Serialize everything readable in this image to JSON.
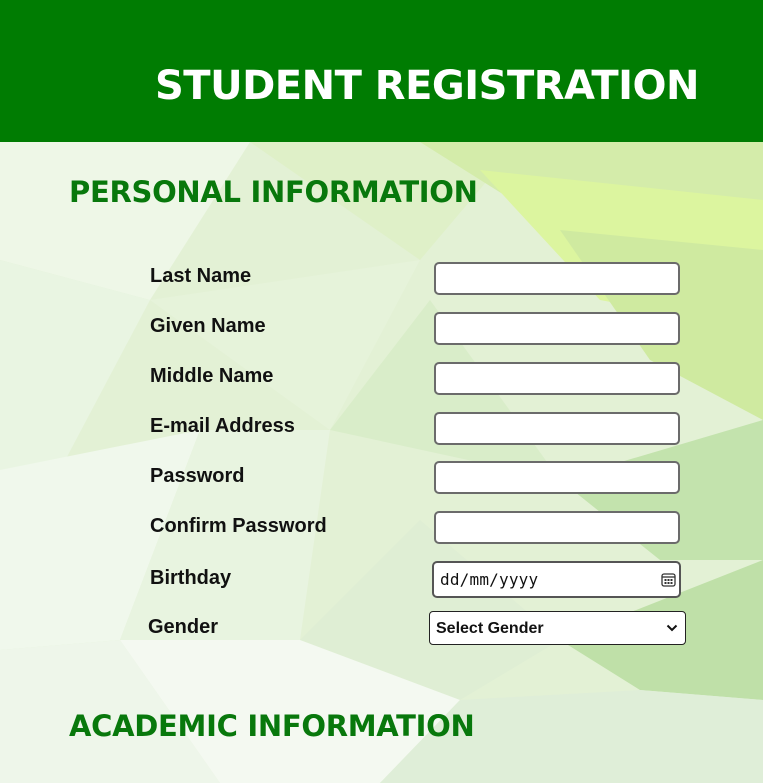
{
  "header": {
    "title": "STUDENT REGISTRATION"
  },
  "sections": {
    "personal_title": "PERSONAL INFORMATION",
    "academic_title": "ACADEMIC INFORMATION"
  },
  "form": {
    "last_name_label": "Last Name",
    "given_name_label": "Given Name",
    "middle_name_label": "Middle Name",
    "email_label": "E-mail Address",
    "password_label": "Password",
    "confirm_password_label": "Confirm Password",
    "birthday_label": "Birthday",
    "birthday_placeholder": "dd/mm/yyyy",
    "gender_label": "Gender",
    "gender_selected": "Select Gender"
  },
  "icons": {
    "birthday_picker": "calendar-icon",
    "gender_dropdown": "chevron-down-icon"
  },
  "colors": {
    "header_bg": "#007c02",
    "section_title": "#08780c"
  }
}
